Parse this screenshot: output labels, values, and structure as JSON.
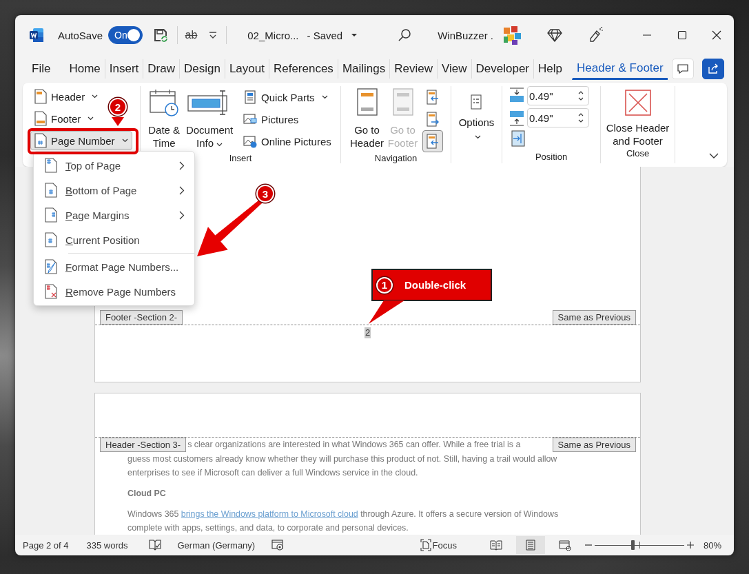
{
  "title_bar": {
    "autosave_label": "AutoSave",
    "autosave": {
      "on": true,
      "text": "On"
    },
    "quick_access": "ab",
    "document_name": "02_Micro...",
    "save_status": "- Saved",
    "user_name": "WinBuzzer ."
  },
  "ribbon_tabs": [
    {
      "label": "File",
      "selected": false
    },
    {
      "label": "Home",
      "selected": false
    },
    {
      "label": "Insert",
      "selected": false
    },
    {
      "label": "Draw",
      "selected": false
    },
    {
      "label": "Design",
      "selected": false
    },
    {
      "label": "Layout",
      "selected": false
    },
    {
      "label": "References",
      "selected": false
    },
    {
      "label": "Mailings",
      "selected": false
    },
    {
      "label": "Review",
      "selected": false
    },
    {
      "label": "View",
      "selected": false
    },
    {
      "label": "Developer",
      "selected": false
    },
    {
      "label": "Help",
      "selected": false
    },
    {
      "label": "Header & Footer",
      "selected": true
    }
  ],
  "ribbon": {
    "page_group": {
      "buttons": [
        {
          "label": "Header",
          "dropdown": true,
          "pressed": false
        },
        {
          "label": "Footer",
          "dropdown": true,
          "pressed": false
        },
        {
          "label": "Page Number",
          "dropdown": true,
          "pressed": true
        }
      ]
    },
    "insert": {
      "label": "Insert",
      "large_buttons": [
        {
          "label_lines": [
            "Date &",
            "Time"
          ],
          "dropdown": false
        },
        {
          "label_lines": [
            "Document",
            "Info"
          ],
          "dropdown": true
        }
      ],
      "small_buttons": [
        {
          "label": "Quick Parts",
          "dropdown": true
        },
        {
          "label": "Pictures",
          "dropdown": false
        },
        {
          "label": "Online Pictures",
          "dropdown": false
        }
      ]
    },
    "navigation": {
      "label": "Navigation",
      "large_buttons": [
        {
          "label_lines": [
            "Go to",
            "Header"
          ],
          "disabled": false
        },
        {
          "label_lines": [
            "Go to",
            "Footer"
          ],
          "disabled": true
        }
      ],
      "small_buttons": [
        {
          "selected": false
        },
        {
          "selected": false
        },
        {
          "selected": true
        }
      ]
    },
    "options": {
      "label": "Options",
      "dropdown": true
    },
    "position": {
      "label": "Position",
      "spinners": [
        {
          "value": "0.49\""
        },
        {
          "value": "0.49\""
        }
      ]
    },
    "close": {
      "label": "Close",
      "label_lines": [
        "Close Header",
        "and Footer"
      ]
    }
  },
  "page_number_menu": [
    {
      "label": "Top of Page",
      "kind": "insert",
      "submenu": true
    },
    {
      "label": "Bottom of Page",
      "kind": "insert",
      "submenu": true
    },
    {
      "label": "Page Margins",
      "kind": "insert",
      "submenu": true
    },
    {
      "label": "Current Position",
      "kind": "insert",
      "submenu": false
    },
    {
      "label": "Format Page Numbers...",
      "kind": "command",
      "submenu": false
    },
    {
      "label": "Remove Page Numbers",
      "kind": "command",
      "submenu": false
    }
  ],
  "document": {
    "footer_tag": "Footer -Section 2-",
    "footer_same_as_previous": "Same as Previous",
    "page_number": "2",
    "header_tag": "Header -Section 3-",
    "header_same_as_previous": "Same as Previous",
    "first_line": "s clear organizations are interested in what Windows 365 can offer. While a free trial is a",
    "paragraph_rest": [
      "guess most customers already know whether they will purchase this product of not. Still, having a trail would allow",
      "enterprises to see if Microsoft can deliver a full Windows service in the cloud."
    ],
    "heading": "Cloud PC",
    "link_paragraph": {
      "before": "Windows 365 ",
      "link": "brings the Windows platform to Microsoft cloud",
      "after": " through Azure. It offers a secure version of Windows",
      "continuation": "complete with apps, settings, and data, to corporate and personal devices."
    }
  },
  "status_bar": {
    "page": "Page 2 of 4",
    "words": "335 words",
    "language": "German (Germany)",
    "focus": "Focus",
    "views": [
      {
        "selected": false
      },
      {
        "selected": true
      },
      {
        "selected": false
      }
    ],
    "zoom": {
      "level": 0.42,
      "reading": "80%"
    }
  },
  "annotations": [
    {
      "number": "1",
      "text": "Double-click"
    },
    {
      "number": "2"
    },
    {
      "number": "3"
    }
  ]
}
